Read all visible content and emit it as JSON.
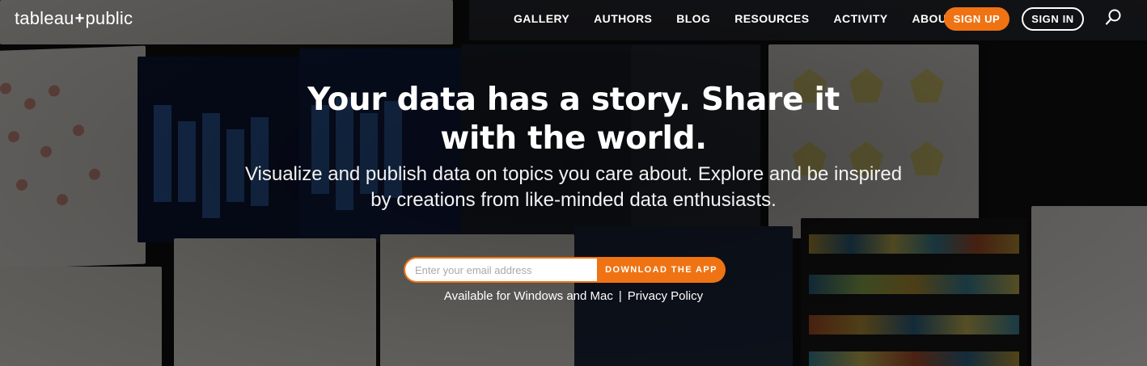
{
  "brand": {
    "logo_text_left": "tableau",
    "logo_plus": "+",
    "logo_text_right": "public"
  },
  "nav": {
    "items": [
      {
        "label": "GALLERY"
      },
      {
        "label": "AUTHORS"
      },
      {
        "label": "BLOG"
      },
      {
        "label": "RESOURCES"
      },
      {
        "label": "ACTIVITY"
      },
      {
        "label": "ABOUT"
      }
    ],
    "signup_label": "SIGN UP",
    "signin_label": "SIGN IN",
    "search_icon": "search-icon"
  },
  "hero": {
    "headline": "Your data has a story. Share it with the world.",
    "subline": "Visualize and publish data on topics you care about. Explore and be inspired by creations from like-minded data enthusiasts."
  },
  "signup": {
    "email_placeholder": "Enter your email address",
    "download_label": "DOWNLOAD THE APP"
  },
  "footnote": {
    "availability": "Available for Windows and Mac",
    "separator": "|",
    "privacy_link": "Privacy Policy"
  },
  "colors": {
    "accent": "#ef7313",
    "text": "#ffffff"
  }
}
